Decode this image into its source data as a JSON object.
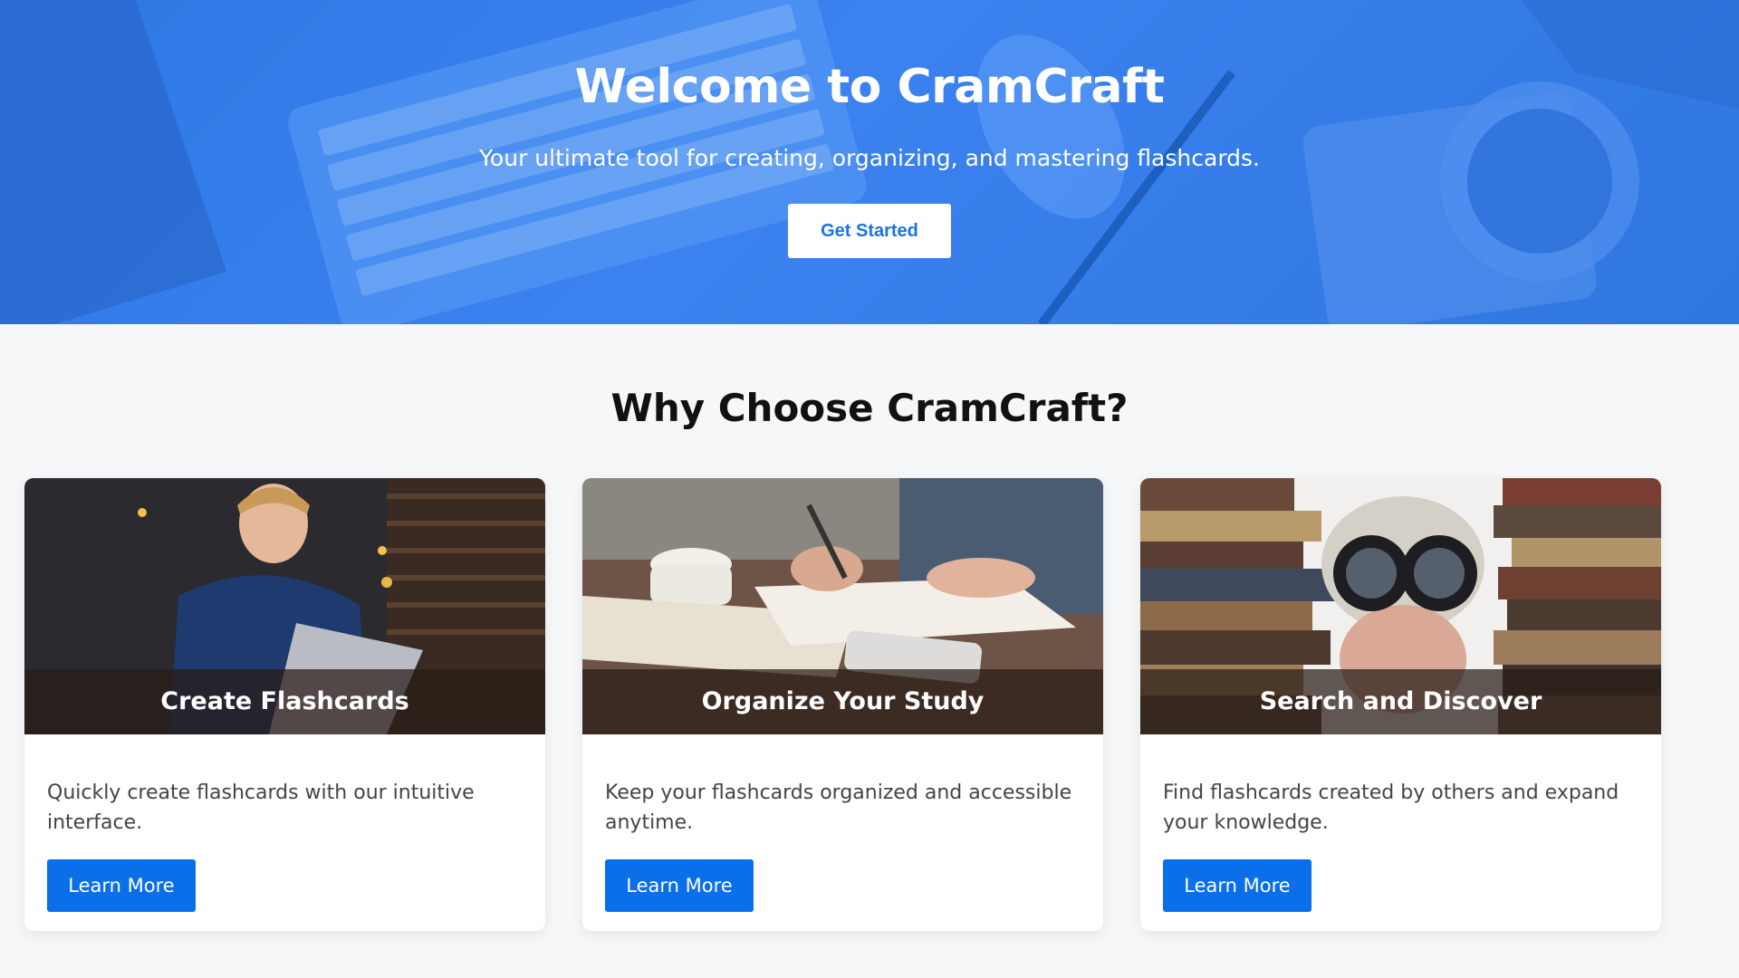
{
  "hero": {
    "title": "Welcome to CramCraft",
    "subtitle": "Your ultimate tool for creating, organizing, and mastering flashcards.",
    "cta_label": "Get Started"
  },
  "features": {
    "title": "Why Choose CramCraft?",
    "cards": [
      {
        "caption": "Create Flashcards",
        "description": "Quickly create flashcards with our intuitive interface.",
        "button_label": "Learn More"
      },
      {
        "caption": "Organize Your Study",
        "description": "Keep your flashcards organized and accessible anytime.",
        "button_label": "Learn More"
      },
      {
        "caption": "Search and Discover",
        "description": "Find flashcards created by others and expand your knowledge.",
        "button_label": "Learn More"
      }
    ]
  },
  "colors": {
    "hero_blue": "#3b82f0",
    "primary_button": "#0a6fe8",
    "page_background": "#f6f7f9"
  }
}
